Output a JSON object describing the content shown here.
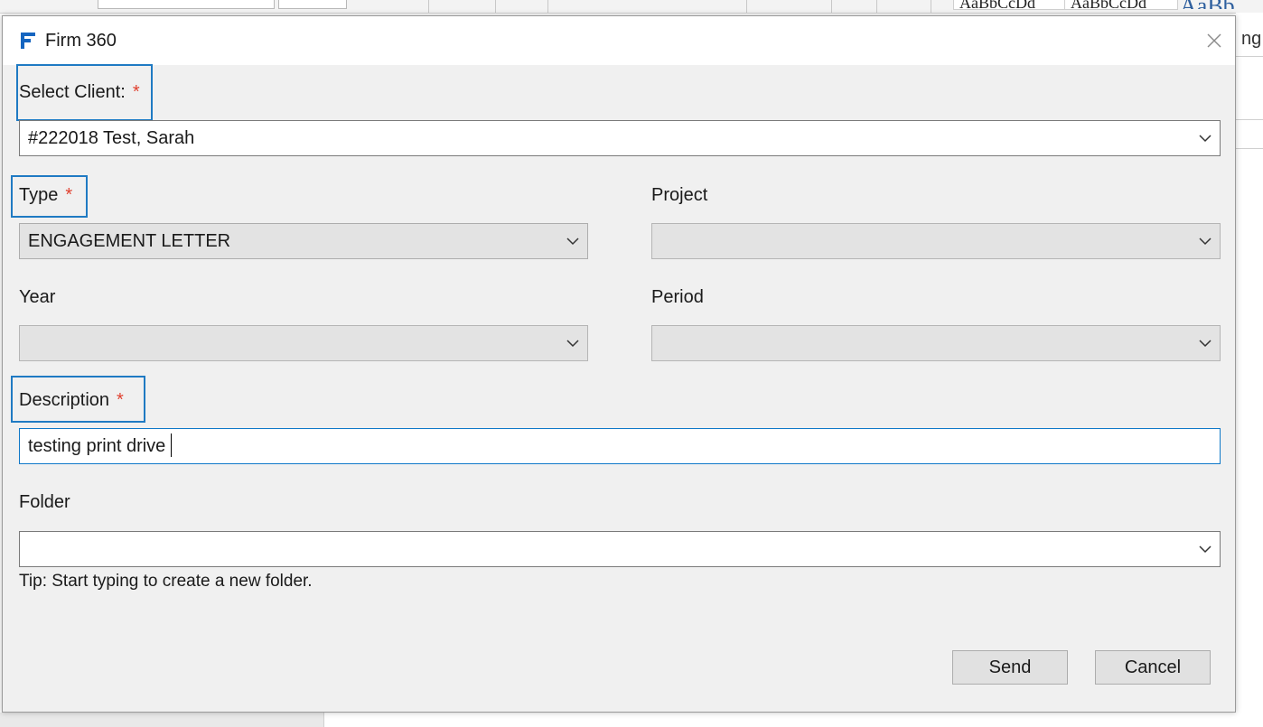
{
  "background_app": {
    "style_previews": [
      "AaBbCcDd",
      "AaBbCcDd",
      "AaBb"
    ],
    "right_fragment": "ng"
  },
  "dialog": {
    "title": "Firm 360",
    "fields": {
      "client": {
        "label": "Select Client:",
        "required_mark": "*",
        "value": "#222018 Test, Sarah"
      },
      "type": {
        "label": "Type",
        "required_mark": "*",
        "value": "ENGAGEMENT LETTER"
      },
      "project": {
        "label": "Project",
        "value": ""
      },
      "year": {
        "label": "Year",
        "value": ""
      },
      "period": {
        "label": "Period",
        "value": ""
      },
      "description": {
        "label": "Description",
        "required_mark": "*",
        "value": "testing print drive"
      },
      "folder": {
        "label": "Folder",
        "value": ""
      }
    },
    "tip": "Tip: Start typing to create a new folder.",
    "buttons": {
      "send": "Send",
      "cancel": "Cancel"
    }
  },
  "colors": {
    "highlight": "#1f7ac3",
    "required": "#e0402f",
    "brand_icon": "#1565c0"
  }
}
